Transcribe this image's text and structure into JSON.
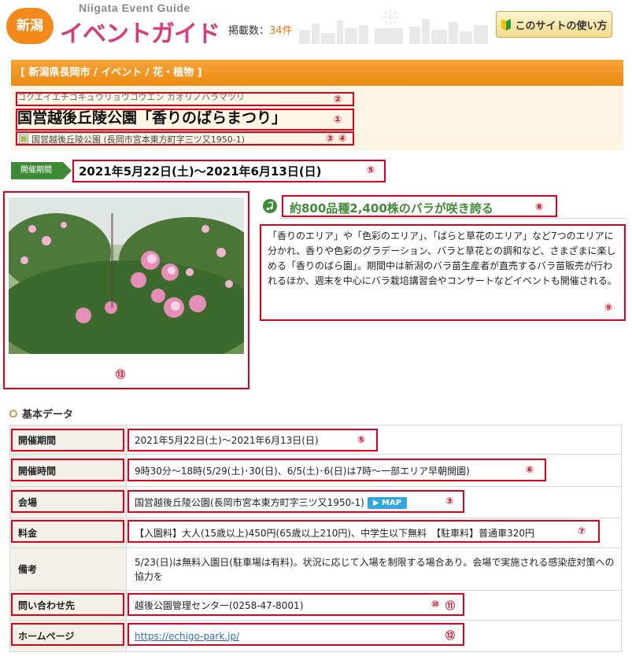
{
  "header": {
    "logo_badge": "新潟",
    "logo_sub": "Niigata Event Guide",
    "logo_main": "イベントガイド",
    "count_label": "掲載数：",
    "count_value": "34件",
    "howto_label": "このサイトの使い方"
  },
  "breadcrumb": "[ 新潟県長岡市 / イベント / 花・植物 ]",
  "event": {
    "kana": "コクエイエチゴキュウリョウコウエン カオリノバラマツリ",
    "title": "国営越後丘陵公園「香りのばらまつり」",
    "venue_line": "国営越後丘陵公園 (長岡市宮本東方町字三ツ又1950-1)",
    "period_tag": "開催期間",
    "period": "2021年5月22日(土)～2021年6月13日(日)",
    "catch": "約800品種2,400株のバラが咲き誇る",
    "description": "「香りのエリア」や「色彩のエリア」、「ばらと草花のエリア」など7つのエリアに分かれ、香りや色彩のグラデーション、バラと草花との調和など、さまざまに楽しめる「香りのばら園」。期間中は新潟のバラ苗生産者が直売するバラ苗販売が行われるほか、週末を中心にバラ栽培講習会やコンサートなどイベントも開催される。"
  },
  "annotations": {
    "n1": "①",
    "n2": "②",
    "n3": "③",
    "n4": "④",
    "n5": "⑤",
    "n6": "⑥",
    "n7": "⑦",
    "n8": "⑧",
    "n9": "⑨",
    "n10": "⑩",
    "n11": "⑪",
    "n12": "⑫",
    "n13": "⑬"
  },
  "basic_data": {
    "heading": "基本データ",
    "rows": [
      {
        "key": "開催期間",
        "value": "2021年5月22日(土)～2021年6月13日(日)"
      },
      {
        "key": "開催時間",
        "value": "9時30分～18時(5/29(土)･30(日)、6/5(土)･6(日)は7時～一部エリア早朝開園)"
      },
      {
        "key": "会場",
        "value": "国営越後丘陵公園(長岡市宮本東方町字三ツ又1950-1)",
        "button": "▶ MAP"
      },
      {
        "key": "料金",
        "value": "【入園料】大人(15歳以上)450円(65歳以上210円)、中学生以下無料　【駐車料】普通車320円"
      },
      {
        "key": "備考",
        "value": "5/23(日)は無料入園日(駐車場は有料)。状況に応じて入場を制限する場合あり。会場で実施される感染症対策への協力を"
      },
      {
        "key": "問い合わせ先",
        "value": "越後公園管理センター(0258-47-8001)"
      },
      {
        "key": "ホームページ",
        "value": "https://echigo-park.jp/"
      }
    ]
  },
  "colors": {
    "accent_orange": "#ed8a12",
    "accent_green": "#3f8a36",
    "annotation_red": "#e0001a",
    "title_bg": "#fff5e4"
  }
}
